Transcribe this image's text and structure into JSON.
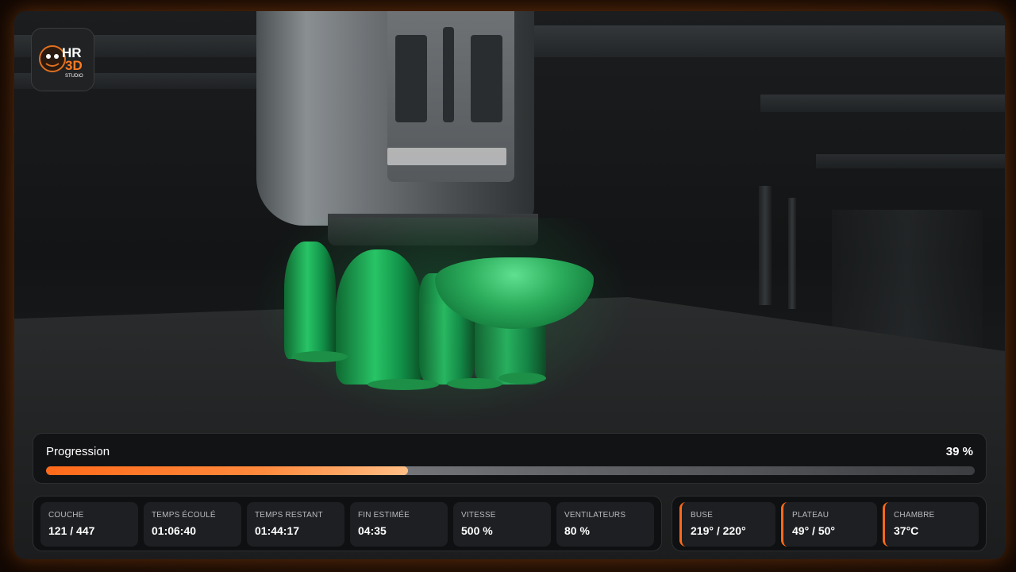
{
  "logo": {
    "text_top": "HR",
    "text_bottom": "3D",
    "sub": "STUDIO"
  },
  "progress": {
    "label": "Progression",
    "value_text": "39 %",
    "fraction": 0.39
  },
  "stats": [
    {
      "key": "layer",
      "label": "COUCHE",
      "value": "121 / 447"
    },
    {
      "key": "elapsed",
      "label": "TEMPS ÉCOULÉ",
      "value": "01:06:40"
    },
    {
      "key": "remaining",
      "label": "TEMPS RESTANT",
      "value": "01:44:17"
    },
    {
      "key": "eta",
      "label": "FIN ESTIMÉE",
      "value": "04:35"
    },
    {
      "key": "speed",
      "label": "VITESSE",
      "value": "500 %"
    },
    {
      "key": "fans",
      "label": "VENTILATEURS",
      "value": "80 %"
    }
  ],
  "temps": [
    {
      "key": "nozzle",
      "label": "BUSE",
      "value": "219° / 220°"
    },
    {
      "key": "bed",
      "label": "PLATEAU",
      "value": "49° / 50°"
    },
    {
      "key": "chamber",
      "label": "CHAMBRE",
      "value": "37°C"
    }
  ],
  "colors": {
    "accent": "#ff6a1a",
    "panel": "#121315",
    "card": "#1d1f22",
    "print": "#28c466"
  }
}
